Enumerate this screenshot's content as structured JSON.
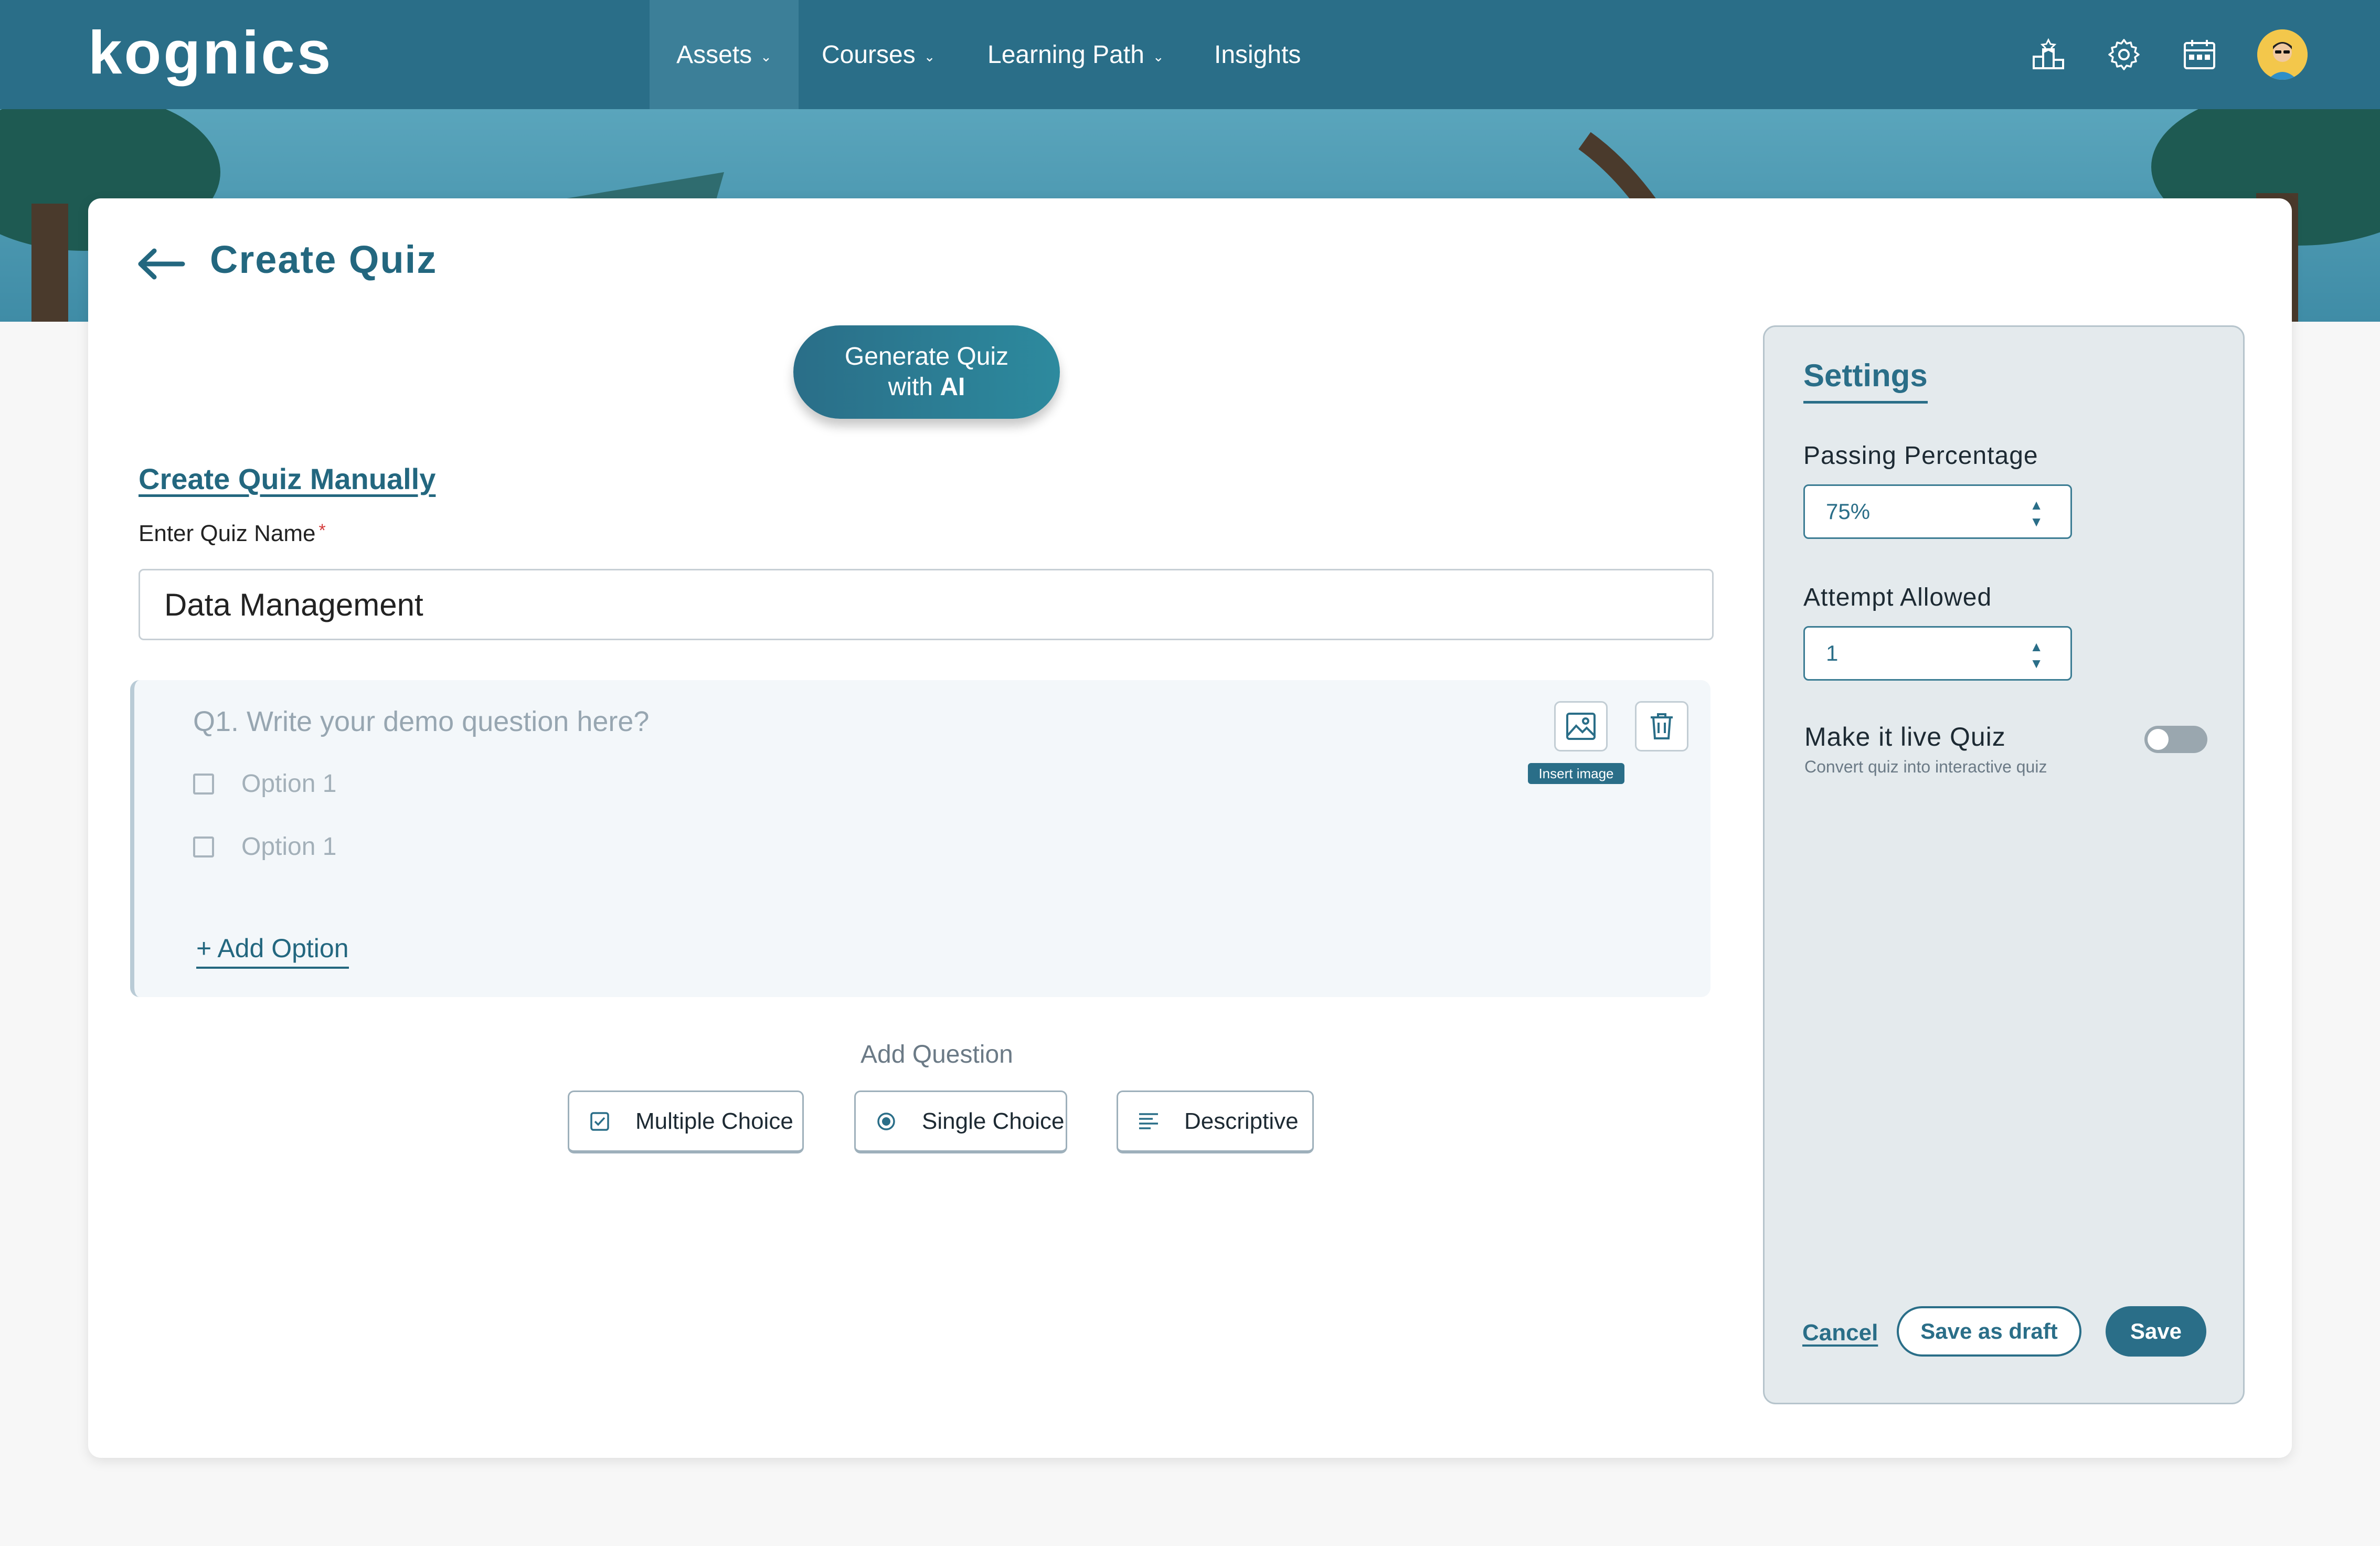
{
  "app": {
    "logo": "kognics"
  },
  "nav": {
    "items": [
      {
        "label": "Assets",
        "has_dropdown": true,
        "active": true
      },
      {
        "label": "Courses",
        "has_dropdown": true,
        "active": false
      },
      {
        "label": "Learning Path",
        "has_dropdown": true,
        "active": false
      },
      {
        "label": "Insights",
        "has_dropdown": false,
        "active": false
      }
    ],
    "icons": [
      "leaderboard-icon",
      "gear-icon",
      "calendar-icon",
      "avatar"
    ]
  },
  "page": {
    "title": "Create Quiz",
    "generate_button": {
      "line1": "Generate Quiz",
      "line2_prefix": "with ",
      "line2_bold": "AI"
    },
    "manual_link": "Create Quiz Manually",
    "name_label": "Enter Quiz Name",
    "name_required": "*",
    "name_value": "Data Management"
  },
  "question": {
    "placeholder": "Q1. Write your demo question here?",
    "options": [
      "Option 1",
      "Option 1"
    ],
    "add_option": "+  Add Option",
    "insert_image_tooltip": "Insert image"
  },
  "add_question": {
    "label": "Add Question",
    "types": [
      "Multiple Choice",
      "Single Choice",
      "Descriptive"
    ]
  },
  "settings": {
    "title": "Settings",
    "passing_label": "Passing Percentage",
    "passing_value": "75%",
    "attempt_label": "Attempt Allowed",
    "attempt_value": "1",
    "live_label": "Make it live Quiz",
    "live_sub": "Convert quiz into interactive quiz",
    "live_enabled": false,
    "cancel": "Cancel",
    "draft": "Save as draft",
    "save": "Save"
  },
  "colors": {
    "primary": "#2a6e88",
    "accent_text": "#23677f",
    "settings_bg": "#e4eaed"
  }
}
